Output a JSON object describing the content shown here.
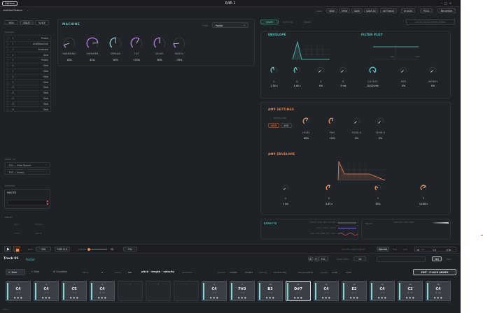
{
  "window": {
    "title": "R4E-1",
    "options_label": "Options",
    "preset_name": "Untitled Pattern"
  },
  "topbar": {
    "load_label": "LOAD",
    "buttons": [
      "NEW",
      "OPEN",
      "SAVE",
      "SAVE AS",
      "SETTINGS"
    ],
    "right_buttons": [
      "STUDIO",
      "POOL",
      "BROWSER"
    ]
  },
  "left": {
    "tabs": [
      "MIDI",
      "SOLO",
      "VOICE"
    ],
    "tracks_label": "TRACKS",
    "tracks": [
      {
        "num": "1",
        "name": "Partial"
      },
      {
        "num": "2",
        "name": "AnaResonium"
      },
      {
        "num": "3",
        "name": "Anatrace"
      },
      {
        "num": "4",
        "name": "Acid"
      },
      {
        "num": "5",
        "name": "Partial"
      },
      {
        "num": "6",
        "name": "Stab"
      },
      {
        "num": "7",
        "name": "Stab"
      },
      {
        "num": "8",
        "name": "Stab"
      },
      {
        "num": "9",
        "name": "Stab"
      },
      {
        "num": "10",
        "name": "Stab"
      },
      {
        "num": "11",
        "name": "Stab"
      },
      {
        "num": "12",
        "name": "Stab"
      },
      {
        "num": "13",
        "name": "Stab"
      },
      {
        "num": "14",
        "name": "Stab"
      }
    ],
    "send_fx_label": "SEND FX",
    "send_fx": [
      "FX1 — Plate Reverb",
      "FX2 — Empty"
    ],
    "master_label": "MASTER",
    "master_name": "MASTER",
    "mode_label": "MODE",
    "mode_buttons": [
      "Sync",
      "Trigger",
      "Hold",
      "Retrig"
    ]
  },
  "machine": {
    "title": "MACHINE",
    "type_label": "TYPE",
    "type_value": "Partial",
    "knobs": [
      {
        "label": "HARMONIC",
        "value": "10%",
        "color": "#b278d8",
        "level": 0.1
      },
      {
        "label": "SHIMMER",
        "value": "81%",
        "color": "#b278d8",
        "level": 0.81
      },
      {
        "label": "SPREAD",
        "value": "50%",
        "color": "#8ad2d8",
        "level": 0.5
      },
      {
        "label": "TILT",
        "value": "+21%",
        "color": "#b278d8",
        "level": 0.6
      },
      {
        "label": "NOISE",
        "value": "50%",
        "color": "#b278d8",
        "level": 0.5
      },
      {
        "label": "WIDTH",
        "value": "-70%",
        "color": "#b278d8",
        "level": 0.15
      }
    ]
  },
  "shape": {
    "tabs": [
      "SHAPE",
      "EFFECTS",
      "DRAW"
    ],
    "show_mod_label": "SHOW MODULATION PANEL",
    "envelope_title": "ENVELOPE",
    "filter_title": "FILTER PLOT",
    "filter_axis": [
      "LOW",
      "HIGH"
    ],
    "knobs": [
      {
        "label": "A",
        "value": "1.50 s",
        "level": 0.45
      },
      {
        "label": "D",
        "value": "1.40 s",
        "level": 0.4
      },
      {
        "label": "S",
        "value": "0%",
        "level": 0.0
      },
      {
        "label": "R",
        "value": "0 ms",
        "level": 0.0
      },
      {
        "label": "CUTOFF",
        "value": "20.00 kHz",
        "level": 1.0
      },
      {
        "label": "RES",
        "value": "0%",
        "level": 0.0
      },
      {
        "label": "MORPH",
        "value": "0%",
        "level": 0.0
      }
    ]
  },
  "amp": {
    "title": "AMP SETTINGS",
    "envelope_label": "ENVELOPE",
    "env_modes": [
      "ADSR",
      "ASD"
    ],
    "knobs": [
      {
        "label": "LEVEL",
        "value": "60%",
        "level": 0.6
      },
      {
        "label": "PAN",
        "value": "+0%",
        "level": 0.5
      },
      {
        "label": "SEND A",
        "value": "0%",
        "level": 0.0
      },
      {
        "label": "SEND B",
        "value": "0%",
        "level": 0.0
      }
    ],
    "env_title": "AMP ENVELOPE",
    "env_knobs": [
      {
        "label": "A",
        "value": "1 ms",
        "level": 0.0
      },
      {
        "label": "D",
        "value": "3.45 s",
        "level": 0.55
      },
      {
        "label": "S",
        "value": "30%",
        "level": 0.3
      },
      {
        "label": "R",
        "value": "10.66 s",
        "level": 0.7
      }
    ]
  },
  "effects": {
    "title": "EFFECTS",
    "rows": [
      "DRIVE / POST AMP / ACTIVE",
      "LOCO / LOCO / LOCO",
      "SRR / FRS / RES / FLT / MAX"
    ],
    "track_title": "TRACK",
    "track_info": "SRR DIST / HPF / FADE"
  },
  "transport": {
    "bpm_label": "BPM",
    "bpm": "120",
    "midi_label": "MIDI CLK",
    "swing_label": "SWING",
    "swing_value": "50",
    "fill_label": "FILL",
    "right_label": "MASTER LENGTH MODE",
    "modes": [
      "Natural",
      "Free",
      "Link"
    ],
    "len_value": "16",
    "len_label": "LEN",
    "scale_value": "1.0",
    "steps_value": "1/16"
  },
  "track_header": {
    "track": "Track 01",
    "machine": "Partial",
    "pages": [
      "A",
      "B",
      "C",
      "D"
    ],
    "fill_label": "FILL",
    "page_label": "PAGE STEPS",
    "page_value": "16",
    "seq_label": "SEQ",
    "mix_label": "MIX"
  },
  "modebar": {
    "modes": [
      "Note",
      "Slide",
      "Condition"
    ],
    "micro_label": "Micro",
    "micro_value": "0",
    "lanes_label": "Lanes",
    "lane_value": "Tab",
    "lanes_content": "pitch - length - velocity",
    "semitone_label": "Semitone",
    "octave_label": "Octave",
    "shapes": [
      "SHAPE2",
      "SHAPE3"
    ],
    "velocity_label": "Velocity",
    "vel_range": "A3+D3+TSA",
    "ring_value": "A3+A3+A3T12",
    "length_label": "Length",
    "length_value": "4,24E",
    "extra": "A3/15",
    "edit_label": "EDIT · P-LOCK ARMED"
  },
  "steps": [
    {
      "num": "1",
      "note": "C4",
      "sub": "4 . 2",
      "on": true
    },
    {
      "num": "2",
      "note": "C4",
      "sub": "4 . 3",
      "on": true
    },
    {
      "num": "3",
      "note": "C5",
      "sub": "3 . 4",
      "on": true
    },
    {
      "num": "4",
      "note": "C4",
      "sub": "4 . 73",
      "on": true
    },
    {
      "num": "5",
      "note": "",
      "sub": "",
      "on": false
    },
    {
      "num": "6",
      "note": "",
      "sub": "",
      "on": false
    },
    {
      "num": "7",
      "note": "",
      "sub": "",
      "on": false
    },
    {
      "num": "8",
      "note": "C4",
      "sub": "4 . 2",
      "on": true
    },
    {
      "num": "9",
      "note": "F#3",
      "sub": "3 . 4",
      "on": true
    },
    {
      "num": "10",
      "note": "B3",
      "sub": "3 . 4",
      "on": true
    },
    {
      "num": "11",
      "note": "D#7",
      "sub": "4 . 7",
      "on": true
    },
    {
      "num": "12",
      "note": "C4",
      "sub": "4 . 3",
      "on": true
    },
    {
      "num": "13",
      "note": "E2",
      "sub": "2 . 1",
      "on": true
    },
    {
      "num": "14",
      "note": "C4",
      "sub": "4 . 3",
      "on": true
    },
    {
      "num": "15",
      "note": "C2",
      "sub": "2 . 71",
      "on": true
    },
    {
      "num": "16",
      "note": "C4",
      "sub": "4 . 34",
      "on": true
    }
  ],
  "footer": {
    "label": "R4E-1"
  },
  "colors": {
    "teal": "#55c7c0",
    "orange": "#f0894f",
    "purple": "#b278d8"
  }
}
